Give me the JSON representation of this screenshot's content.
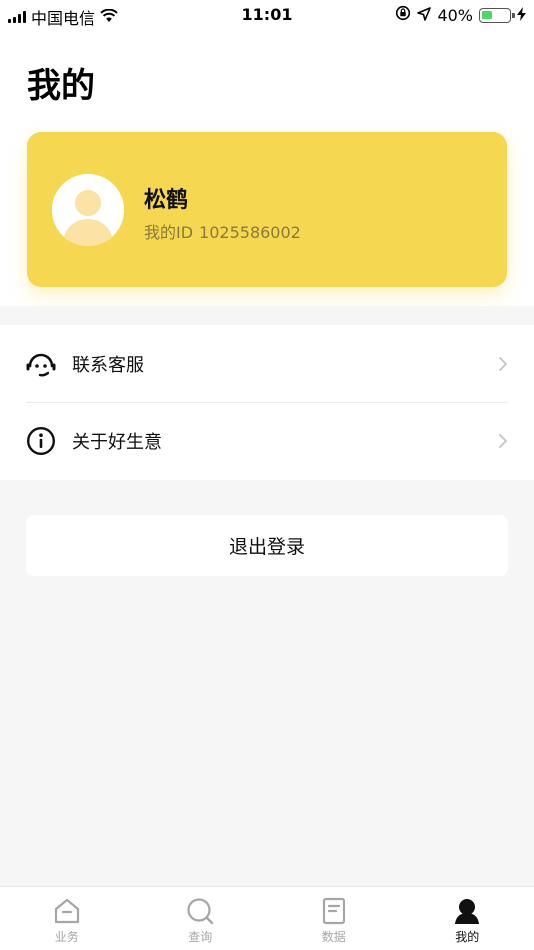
{
  "status_bar": {
    "carrier": "中国电信",
    "time": "11:01",
    "battery_percent_text": "40%",
    "battery_level": 0.4,
    "icons": [
      "signal-icon",
      "wifi-icon",
      "rotation-lock-icon",
      "location-icon",
      "battery-icon",
      "charging-icon"
    ]
  },
  "header": {
    "title": "我的"
  },
  "profile": {
    "name": "松鹤",
    "id_label": "我的ID",
    "id_value": "1025586002",
    "card_color": "#f6d752"
  },
  "menu": {
    "items": [
      {
        "label": "联系客服",
        "icon": "customer-service-icon"
      },
      {
        "label": "关于好生意",
        "icon": "info-icon"
      }
    ]
  },
  "logout": {
    "label": "退出登录"
  },
  "tab_bar": {
    "tabs": [
      {
        "label": "业务",
        "icon": "home-icon",
        "active": false
      },
      {
        "label": "查询",
        "icon": "search-icon",
        "active": false
      },
      {
        "label": "数据",
        "icon": "document-icon",
        "active": false
      },
      {
        "label": "我的",
        "icon": "person-icon",
        "active": true
      }
    ]
  }
}
